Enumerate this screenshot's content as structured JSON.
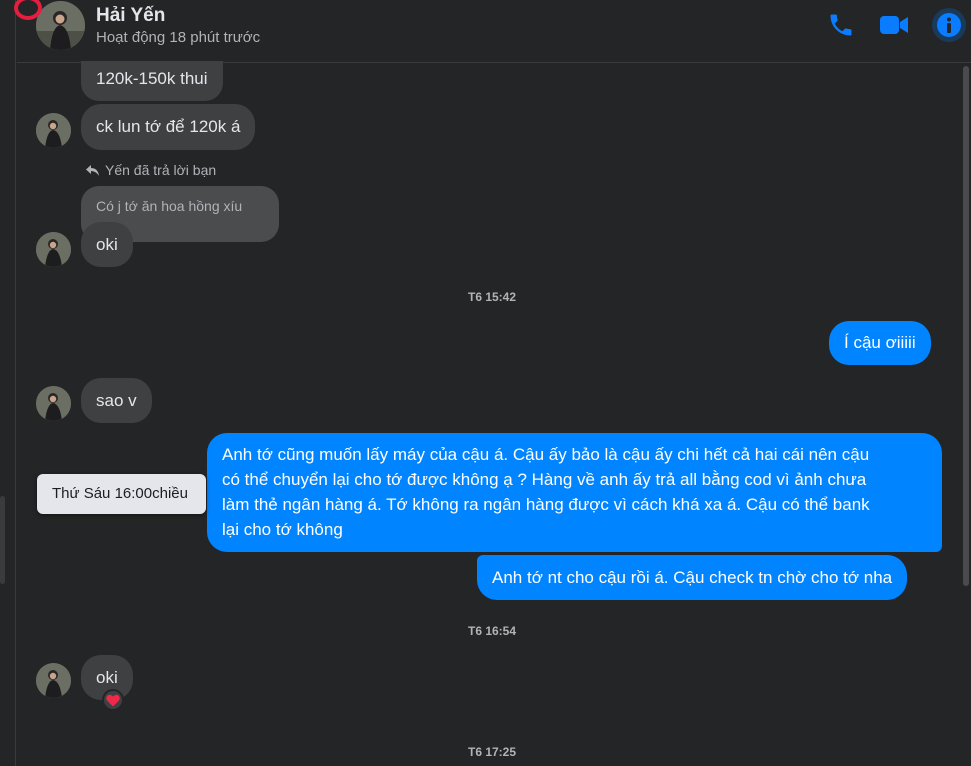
{
  "contact": {
    "name": "Hải Yến",
    "status": "Hoạt động 18 phút trước"
  },
  "icons": {
    "phone": "phone-icon",
    "video": "video-camera-icon",
    "info": "info-icon",
    "reply": "reply-arrow-icon",
    "heart": "heart-icon"
  },
  "colors": {
    "accent": "#0084ff",
    "background": "#242526",
    "incoming_bubble": "#3e4042"
  },
  "messages": {
    "m1": "120k-150k thui",
    "m2": "ck lun tớ để 120k á",
    "reply_note": "Yến đã trả lời bạn",
    "quoted": "Có j tớ ăn hoa hồng xíu",
    "m3": "oki",
    "ts1": "T6 15:42",
    "m4": "Í cậu ơiiiii",
    "m5": "sao v",
    "m6_lines": [
      "Anh tớ cũng muốn lấy máy của cậu á. Cậu ấy bảo là cậu ấy chi hết cả hai cái nên cậu",
      "có thể chuyển lại cho tớ được không ạ ? Hàng về anh ấy trả all bằng cod vì ảnh chưa",
      "làm thẻ ngân hàng á. Tớ không ra ngân hàng được vì cách khá xa á. Cậu có thể bank",
      "lại cho tớ không"
    ],
    "tooltip": "Thứ Sáu 16:00chiều",
    "m7": "Anh tớ nt cho cậu rồi á. Cậu check tn chờ cho tớ nha",
    "ts2": "T6 16:54",
    "m8": "oki",
    "reaction": "❤",
    "ts3": "T6 17:25"
  }
}
